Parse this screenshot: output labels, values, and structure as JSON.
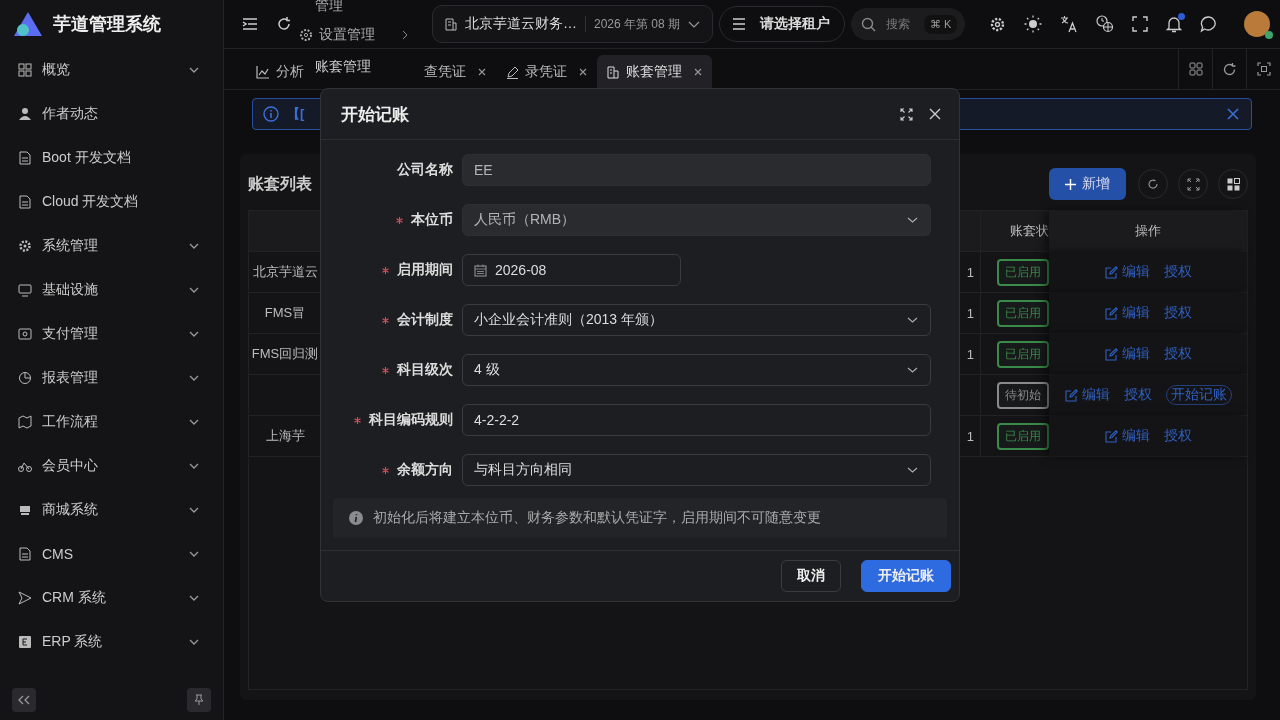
{
  "app": {
    "title": "芋道管理系统"
  },
  "sidebar": {
    "items": [
      {
        "label": "概览",
        "expandable": true
      },
      {
        "label": "作者动态",
        "expandable": false
      },
      {
        "label": "Boot 开发文档",
        "expandable": false
      },
      {
        "label": "Cloud 开发文档",
        "expandable": false
      },
      {
        "label": "系统管理",
        "expandable": true
      },
      {
        "label": "基础设施",
        "expandable": true
      },
      {
        "label": "支付管理",
        "expandable": true
      },
      {
        "label": "报表管理",
        "expandable": true
      },
      {
        "label": "工作流程",
        "expandable": true
      },
      {
        "label": "会员中心",
        "expandable": true
      },
      {
        "label": "商城系统",
        "expandable": true
      },
      {
        "label": "CMS",
        "expandable": true
      },
      {
        "label": "CRM 系统",
        "expandable": true
      },
      {
        "label": "ERP 系统",
        "expandable": true
      }
    ]
  },
  "breadcrumb": [
    "管理",
    "设置管理",
    "账套管理"
  ],
  "header": {
    "account": "北京芋道云财务…",
    "period": "2026 年第 08 期",
    "tenant": "请选择租户",
    "search": {
      "placeholder": "搜索",
      "shortcut": "⌘ K"
    },
    "notification": true
  },
  "tabs": [
    {
      "label": "分析",
      "selected": false,
      "closable": false
    },
    {
      "label": "查凭证",
      "selected": false,
      "closable": true
    },
    {
      "label": "录凭证",
      "selected": false,
      "closable": true
    },
    {
      "label": "账套管理",
      "selected": true,
      "closable": true
    }
  ],
  "alert": {
    "text": "【["
  },
  "card": {
    "title": "账套列表",
    "add_button": "新增"
  },
  "table": {
    "columns": [
      "账套状",
      "操作"
    ],
    "rows": [
      {
        "name": "北京芋道云",
        "column_3": "1",
        "status": "已启用",
        "color": "#3a8a4a",
        "actions": [
          {
            "label": "编辑",
            "kind": "edit"
          },
          {
            "label": "授权",
            "kind": "link"
          }
        ]
      },
      {
        "name": "FMS冒",
        "column_3": "1",
        "status": "已启用",
        "color": "#3a8a4a",
        "actions": [
          {
            "label": "编辑",
            "kind": "edit"
          },
          {
            "label": "授权",
            "kind": "link"
          }
        ]
      },
      {
        "name": "FMS回归测",
        "column_3": "1",
        "status": "已启用",
        "color": "#3a8a4a",
        "actions": [
          {
            "label": "编辑",
            "kind": "edit"
          },
          {
            "label": "授权",
            "kind": "link"
          }
        ]
      },
      {
        "name": "",
        "column_3": "",
        "status": "待初始",
        "color": "#8a8a8a",
        "actions": [
          {
            "label": "编辑",
            "kind": "edit"
          },
          {
            "label": "授权",
            "kind": "link"
          },
          {
            "label": "开始记账",
            "kind": "pill"
          }
        ]
      },
      {
        "name": "上海芋",
        "column_3": "1",
        "status": "已启用",
        "color": "#3a8a4a",
        "actions": [
          {
            "label": "编辑",
            "kind": "edit"
          },
          {
            "label": "授权",
            "kind": "link"
          }
        ]
      }
    ]
  },
  "dialog": {
    "title": "开始记账",
    "fields": [
      {
        "label": "公司名称",
        "value": "EE",
        "kind": "input",
        "required": false,
        "disabled": true
      },
      {
        "label": "本位币",
        "value": "人民币（RMB）",
        "kind": "select",
        "required": true,
        "disabled": true
      },
      {
        "label": "启用期间",
        "value": "2026-08",
        "kind": "date",
        "required": true,
        "disabled": false
      },
      {
        "label": "会计制度",
        "value": "小企业会计准则（2013 年颁）",
        "kind": "select",
        "required": true,
        "disabled": false
      },
      {
        "label": "科目级次",
        "value": "4 级",
        "kind": "select",
        "required": true,
        "disabled": false
      },
      {
        "label": "科目编码规则",
        "value": "4-2-2-2",
        "kind": "input",
        "required": true,
        "disabled": false
      },
      {
        "label": "余额方向",
        "value": "与科目方向相同",
        "kind": "select",
        "required": true,
        "disabled": false
      }
    ],
    "note": "初始化后将建立本位币、财务参数和默认凭证字，启用期间不可随意变更",
    "buttons": [
      {
        "label": "取消",
        "kind": "default"
      },
      {
        "label": "开始记账",
        "kind": "primary"
      }
    ]
  }
}
